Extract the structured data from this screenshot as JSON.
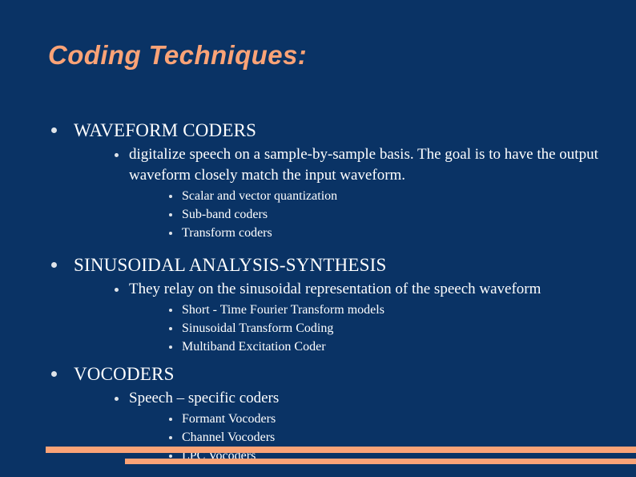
{
  "slide": {
    "title": "Coding Techniques:",
    "background_color": "#0a3365",
    "accent_color": "#fba377",
    "text_color": "#ffffff"
  },
  "outline": {
    "sections": [
      {
        "heading": "WAVEFORM CODERS",
        "detail": "digitalize speech on a sample-by-sample basis. The goal is to have the output waveform closely match the input waveform.",
        "items": [
          "Scalar and vector quantization",
          "Sub-band coders",
          "Transform coders"
        ]
      },
      {
        "heading": "SINUSOIDAL ANALYSIS-SYNTHESIS",
        "detail": "They relay on the sinusoidal representation of the speech waveform",
        "items": [
          "Short - Time Fourier Transform models",
          "Sinusoidal Transform Coding",
          "Multiband Excitation Coder"
        ]
      },
      {
        "heading": "VOCODERS",
        "detail": "Speech – specific coders",
        "items": [
          "Formant Vocoders",
          "Channel Vocoders",
          "LPC Vocoders"
        ]
      }
    ]
  },
  "decoration": {
    "bar_top_color": "#fba377",
    "bar_bottom_color": "#fba377"
  }
}
